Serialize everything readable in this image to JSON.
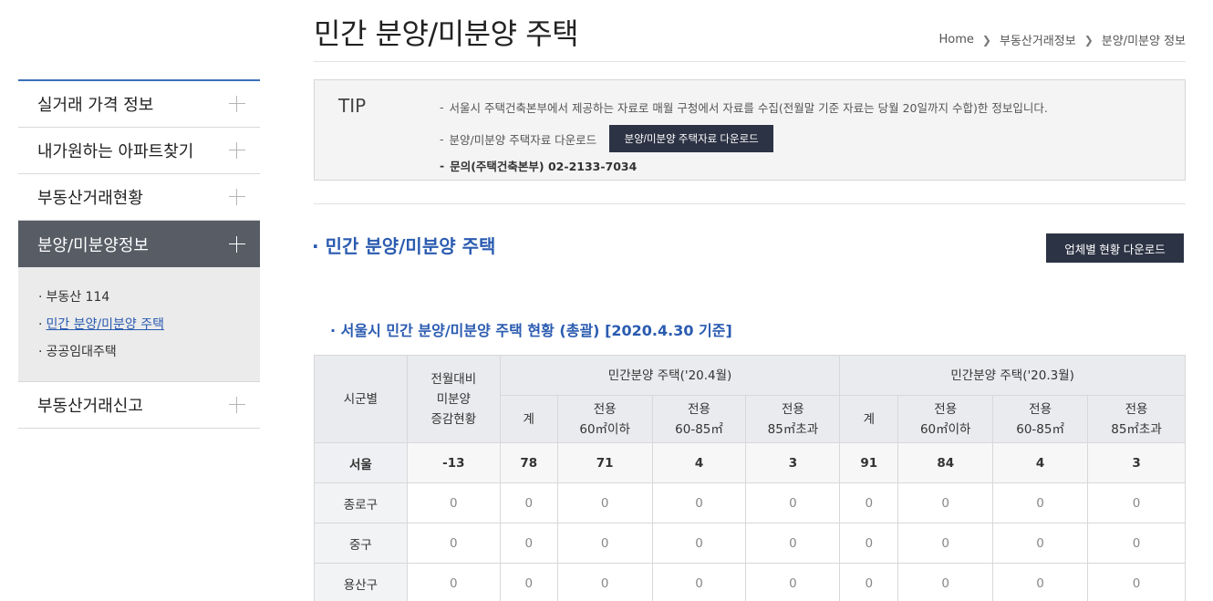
{
  "header": {
    "title": "민간 분양/미분양 주택",
    "breadcrumb": [
      "Home",
      "부동산거래정보",
      "분양/미분양 정보"
    ]
  },
  "sidebar": {
    "items": [
      {
        "label": "실거래 가격 정보"
      },
      {
        "label": "내가원하는 아파트찾기"
      },
      {
        "label": "부동산거래현황"
      },
      {
        "label": "분양/미분양정보"
      },
      {
        "label": "부동산거래신고"
      }
    ],
    "submenu": [
      {
        "label": "부동산 114"
      },
      {
        "label": "민간 분양/미분양 주택"
      },
      {
        "label": "공공임대주택"
      }
    ]
  },
  "tip": {
    "label": "TIP",
    "line1": "서울시 주택건축본부에서 제공하는 자료로 매월 구청에서 자료를 수집(전월말 기준 자료는 당월 20일까지 수합)한 정보입니다.",
    "line2": "분양/미분양 주택자료 다운로드",
    "download_button": "분양/미분양 주택자료 다운로드",
    "line3": "문의(주택건축본부) 02-2133-7034"
  },
  "section": {
    "title": "민간 분양/미분양 주택",
    "company_button": "업체별 현황 다운로드",
    "subtitle": "서울시 민간 분양/미분양 주택 현황 (총괄) [2020.4.30 기준]"
  },
  "table": {
    "h_region": "시군별",
    "h_change": [
      "전월대비",
      "미분양",
      "증감현황"
    ],
    "h_group1": "민간분양 주택('20.4월)",
    "h_group2": "민간분양 주택('20.3월)",
    "sub_total": "계",
    "sub_60": [
      "전용",
      "60㎡이하"
    ],
    "sub_6085": [
      "전용",
      "60-85㎡"
    ],
    "sub_85": [
      "전용",
      "85㎡초과"
    ],
    "rows": [
      {
        "region": "서울",
        "change": "-13",
        "a_total": "78",
        "a_60": "71",
        "a_6085": "4",
        "a_85": "3",
        "b_total": "91",
        "b_60": "84",
        "b_6085": "4",
        "b_85": "3"
      },
      {
        "region": "종로구",
        "change": "0",
        "a_total": "0",
        "a_60": "0",
        "a_6085": "0",
        "a_85": "0",
        "b_total": "0",
        "b_60": "0",
        "b_6085": "0",
        "b_85": "0"
      },
      {
        "region": "중구",
        "change": "0",
        "a_total": "0",
        "a_60": "0",
        "a_6085": "0",
        "a_85": "0",
        "b_total": "0",
        "b_60": "0",
        "b_6085": "0",
        "b_85": "0"
      },
      {
        "region": "용산구",
        "change": "0",
        "a_total": "0",
        "a_60": "0",
        "a_6085": "0",
        "a_85": "0",
        "b_total": "0",
        "b_60": "0",
        "b_6085": "0",
        "b_85": "0"
      }
    ]
  }
}
